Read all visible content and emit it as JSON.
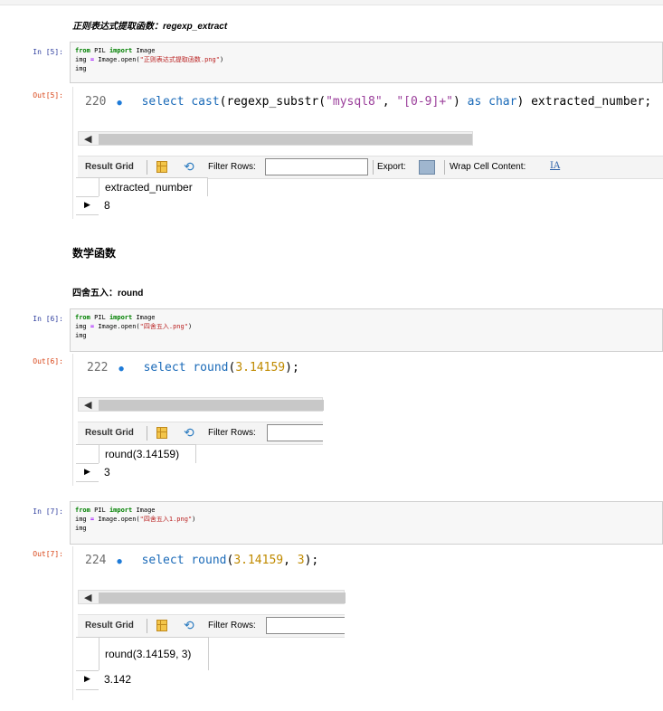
{
  "cells": {
    "md_regexp": "正则表达式提取函数：regexp_extract",
    "md_math": "数学函数",
    "md_round": "四舍五入：round"
  },
  "c5": {
    "in_prompt": "In  [5]:",
    "out_prompt": "Out[5]:",
    "code": [
      "from PIL import Image",
      "img = Image.open(\"正则表达式提取函数.png\")",
      "img"
    ],
    "code_kw1": "from",
    "code_mod": " PIL ",
    "code_kw2": "import",
    "code_cls": " Image",
    "code_l2a": "img ",
    "code_eq": "=",
    "code_l2b": " Image.open(",
    "code_str": "\"正则表达式提取函数.png\"",
    "code_l2c": ")",
    "code_l3": "img",
    "ln": "220",
    "sql_kw": "select",
    "sql_fn": "cast",
    "sql_p1": "(regexp_substr(",
    "sql_s1": "\"mysql8\"",
    "sql_c": ", ",
    "sql_s2": "\"[0-9]+\"",
    "sql_p2": ") ",
    "sql_as": "as",
    "sql_char": "char",
    "sql_p3": ") extracted_number;",
    "col": "extracted_number",
    "val": "8"
  },
  "c6": {
    "in_prompt": "In  [6]:",
    "out_prompt": "Out[6]:",
    "code_str": "\"四舍五入.png\"",
    "ln": "222",
    "sql_kw": "select",
    "sql_fn": "round",
    "sql_p1": "(",
    "sql_num": "3.14159",
    "sql_p2": ");",
    "col": "round(3.14159)",
    "val": "3"
  },
  "c7": {
    "in_prompt": "In  [7]:",
    "out_prompt": "Out[7]:",
    "code_str": "\"四舍五入1.png\"",
    "ln": "224",
    "sql_kw": "select",
    "sql_fn": "round",
    "sql_p1": "(",
    "sql_num1": "3.14159",
    "sql_c": ", ",
    "sql_num2": "3",
    "sql_p2": ");",
    "col": "round(3.14159, 3)",
    "val": "3.142"
  },
  "toolbar": {
    "result_grid": "Result Grid",
    "filter_rows": "Filter Rows:",
    "export": "Export:",
    "wrap": "Wrap Cell Content:",
    "wrap_icon": "IA"
  },
  "code_common": {
    "kw_from": "from",
    "mod": " PIL ",
    "kw_import": "import",
    "cls": " Image",
    "l2a": "img ",
    "eq": "=",
    "l2b": " Image.open(",
    "l2c": ")",
    "l3": "img"
  },
  "icons": {
    "scroll_left": "◀",
    "row_marker": "▶",
    "refresh": "⟲",
    "dot": "●"
  },
  "colors": {
    "in_prompt": "#303f9f",
    "out_prompt": "#d84315",
    "sql_keyword": "#1a6ab8",
    "sql_string": "#9b3f9b",
    "sql_number": "#c08a00"
  }
}
